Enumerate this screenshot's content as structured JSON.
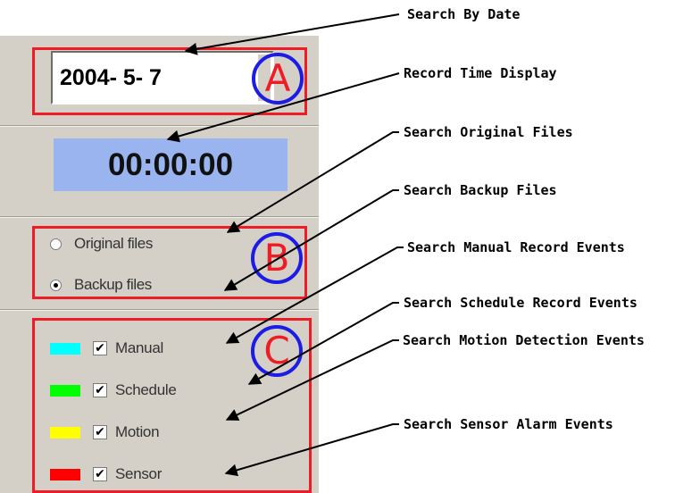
{
  "search_by_date": {
    "value": "2004- 5- 7",
    "marker": "A"
  },
  "record_time": {
    "value": "00:00:00"
  },
  "file_source": {
    "marker": "B",
    "options": [
      {
        "label": "Original files",
        "selected": false
      },
      {
        "label": "Backup files",
        "selected": true
      }
    ]
  },
  "event_types": {
    "marker": "C",
    "items": [
      {
        "label": "Manual",
        "color": "#00ffff",
        "checked": true,
        "check_glyph": "✔"
      },
      {
        "label": "Schedule",
        "color": "#00ff00",
        "checked": true,
        "check_glyph": "✔"
      },
      {
        "label": "Motion",
        "color": "#ffff00",
        "checked": true,
        "check_glyph": "✔"
      },
      {
        "label": "Sensor",
        "color": "#ff0000",
        "checked": true,
        "check_glyph": "✔"
      }
    ]
  },
  "callouts": [
    "Search By Date",
    "Record Time Display",
    "Search Original Files",
    "Search Backup Files",
    "Search Manual Record Events",
    "Search Schedule Record Events",
    "Search Motion Detection Events",
    "Search Sensor Alarm Events"
  ],
  "colors": {
    "panel": "#d4d0c8",
    "highlight_box": "#ee1c24",
    "marker_circle": "#1c1ce4",
    "time_display_bg": "#99b4ee"
  }
}
